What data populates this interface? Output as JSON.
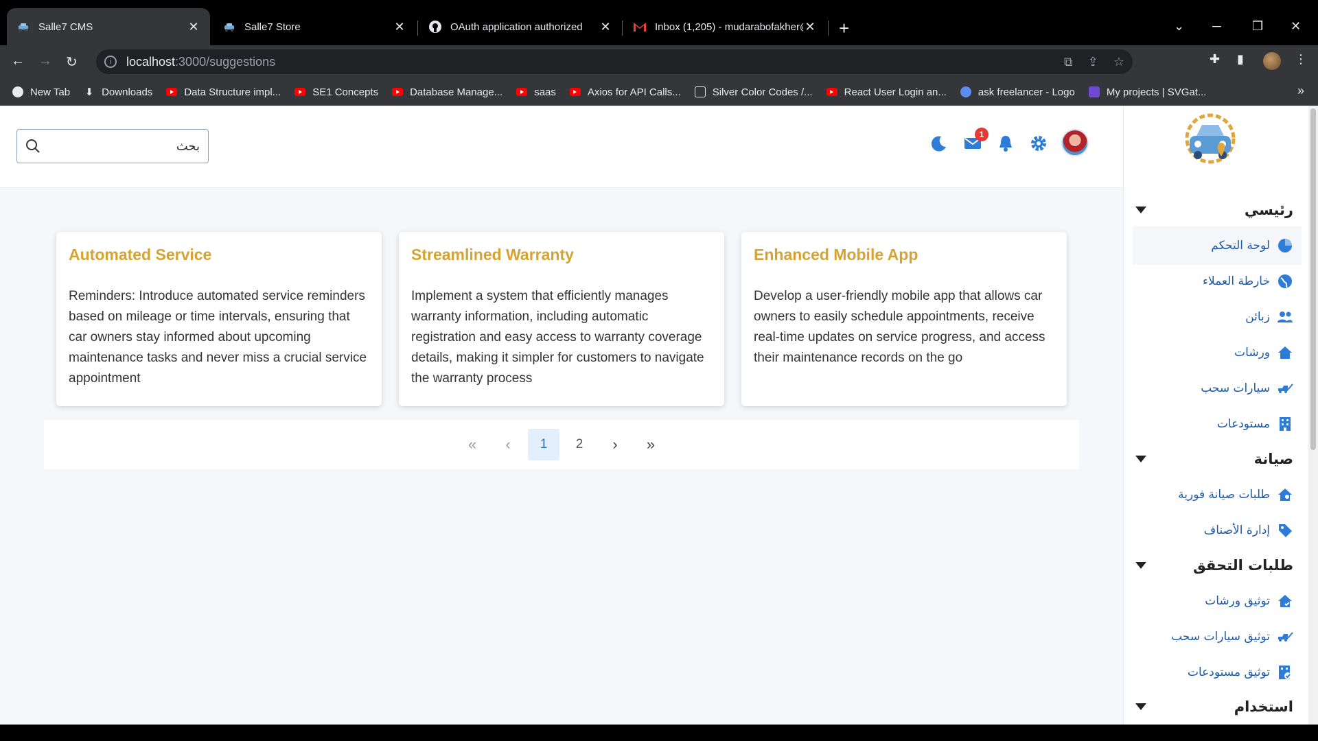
{
  "browser": {
    "tabs": [
      {
        "title": "Salle7 CMS",
        "active": true
      },
      {
        "title": "Salle7 Store",
        "active": false
      },
      {
        "title": "OAuth application authorized",
        "active": false
      },
      {
        "title": "Inbox (1,205) - mudarabofakher@",
        "active": false
      }
    ],
    "address": {
      "host": "localhost",
      "path": ":3000/suggestions"
    },
    "bookmarks": [
      {
        "label": "New Tab",
        "icon": "globe-icon"
      },
      {
        "label": "Downloads",
        "icon": "download-icon"
      },
      {
        "label": "Data Structure impl...",
        "icon": "youtube-icon"
      },
      {
        "label": "SE1 Concepts",
        "icon": "youtube-icon"
      },
      {
        "label": "Database Manage...",
        "icon": "youtube-icon"
      },
      {
        "label": "saas",
        "icon": "youtube-icon"
      },
      {
        "label": "Axios for API Calls...",
        "icon": "youtube-icon"
      },
      {
        "label": "Silver Color Codes /...",
        "icon": "grid-icon"
      },
      {
        "label": "React User Login an...",
        "icon": "youtube-icon"
      },
      {
        "label": "ask freelancer - Logo",
        "icon": "canva-icon"
      },
      {
        "label": "My projects | SVGat...",
        "icon": "svgator-icon"
      }
    ]
  },
  "header": {
    "search_placeholder": "بحث",
    "mail_badge": "1"
  },
  "cards": [
    {
      "title": "Automated Service",
      "body": "Reminders: Introduce automated service reminders based on mileage or time intervals, ensuring that car owners stay informed about upcoming maintenance tasks and never miss a crucial service appointment"
    },
    {
      "title": "Streamlined Warranty",
      "body": "Implement a system that efficiently manages warranty information, including automatic registration and easy access to warranty coverage details, making it simpler for customers to navigate the warranty process"
    },
    {
      "title": "Enhanced Mobile App",
      "body": "Develop a user-friendly mobile app that allows car owners to easily schedule appointments, receive real-time updates on service progress, and access their maintenance records on the go"
    }
  ],
  "pagination": {
    "pages": [
      "1",
      "2"
    ],
    "current": "1"
  },
  "sidebar": {
    "sections": [
      {
        "title": "رئيسي",
        "items": [
          "لوحة التحكم",
          "خارطة العملاء",
          "زبائن",
          "ورشات",
          "سيارات سحب",
          "مستودعات"
        ]
      },
      {
        "title": "صيانة",
        "items": [
          "طلبات صيانة فورية",
          "إدارة الأصناف"
        ]
      },
      {
        "title": "طلبات التحقق",
        "items": [
          "توثيق ورشات",
          "توثيق سيارات سحب",
          "توثيق مستودعات"
        ]
      },
      {
        "title": "استخدام",
        "items": []
      }
    ]
  },
  "colors": {
    "accent": "#1e5aa8",
    "card_title": "#d4a332",
    "badge": "#e53935"
  }
}
